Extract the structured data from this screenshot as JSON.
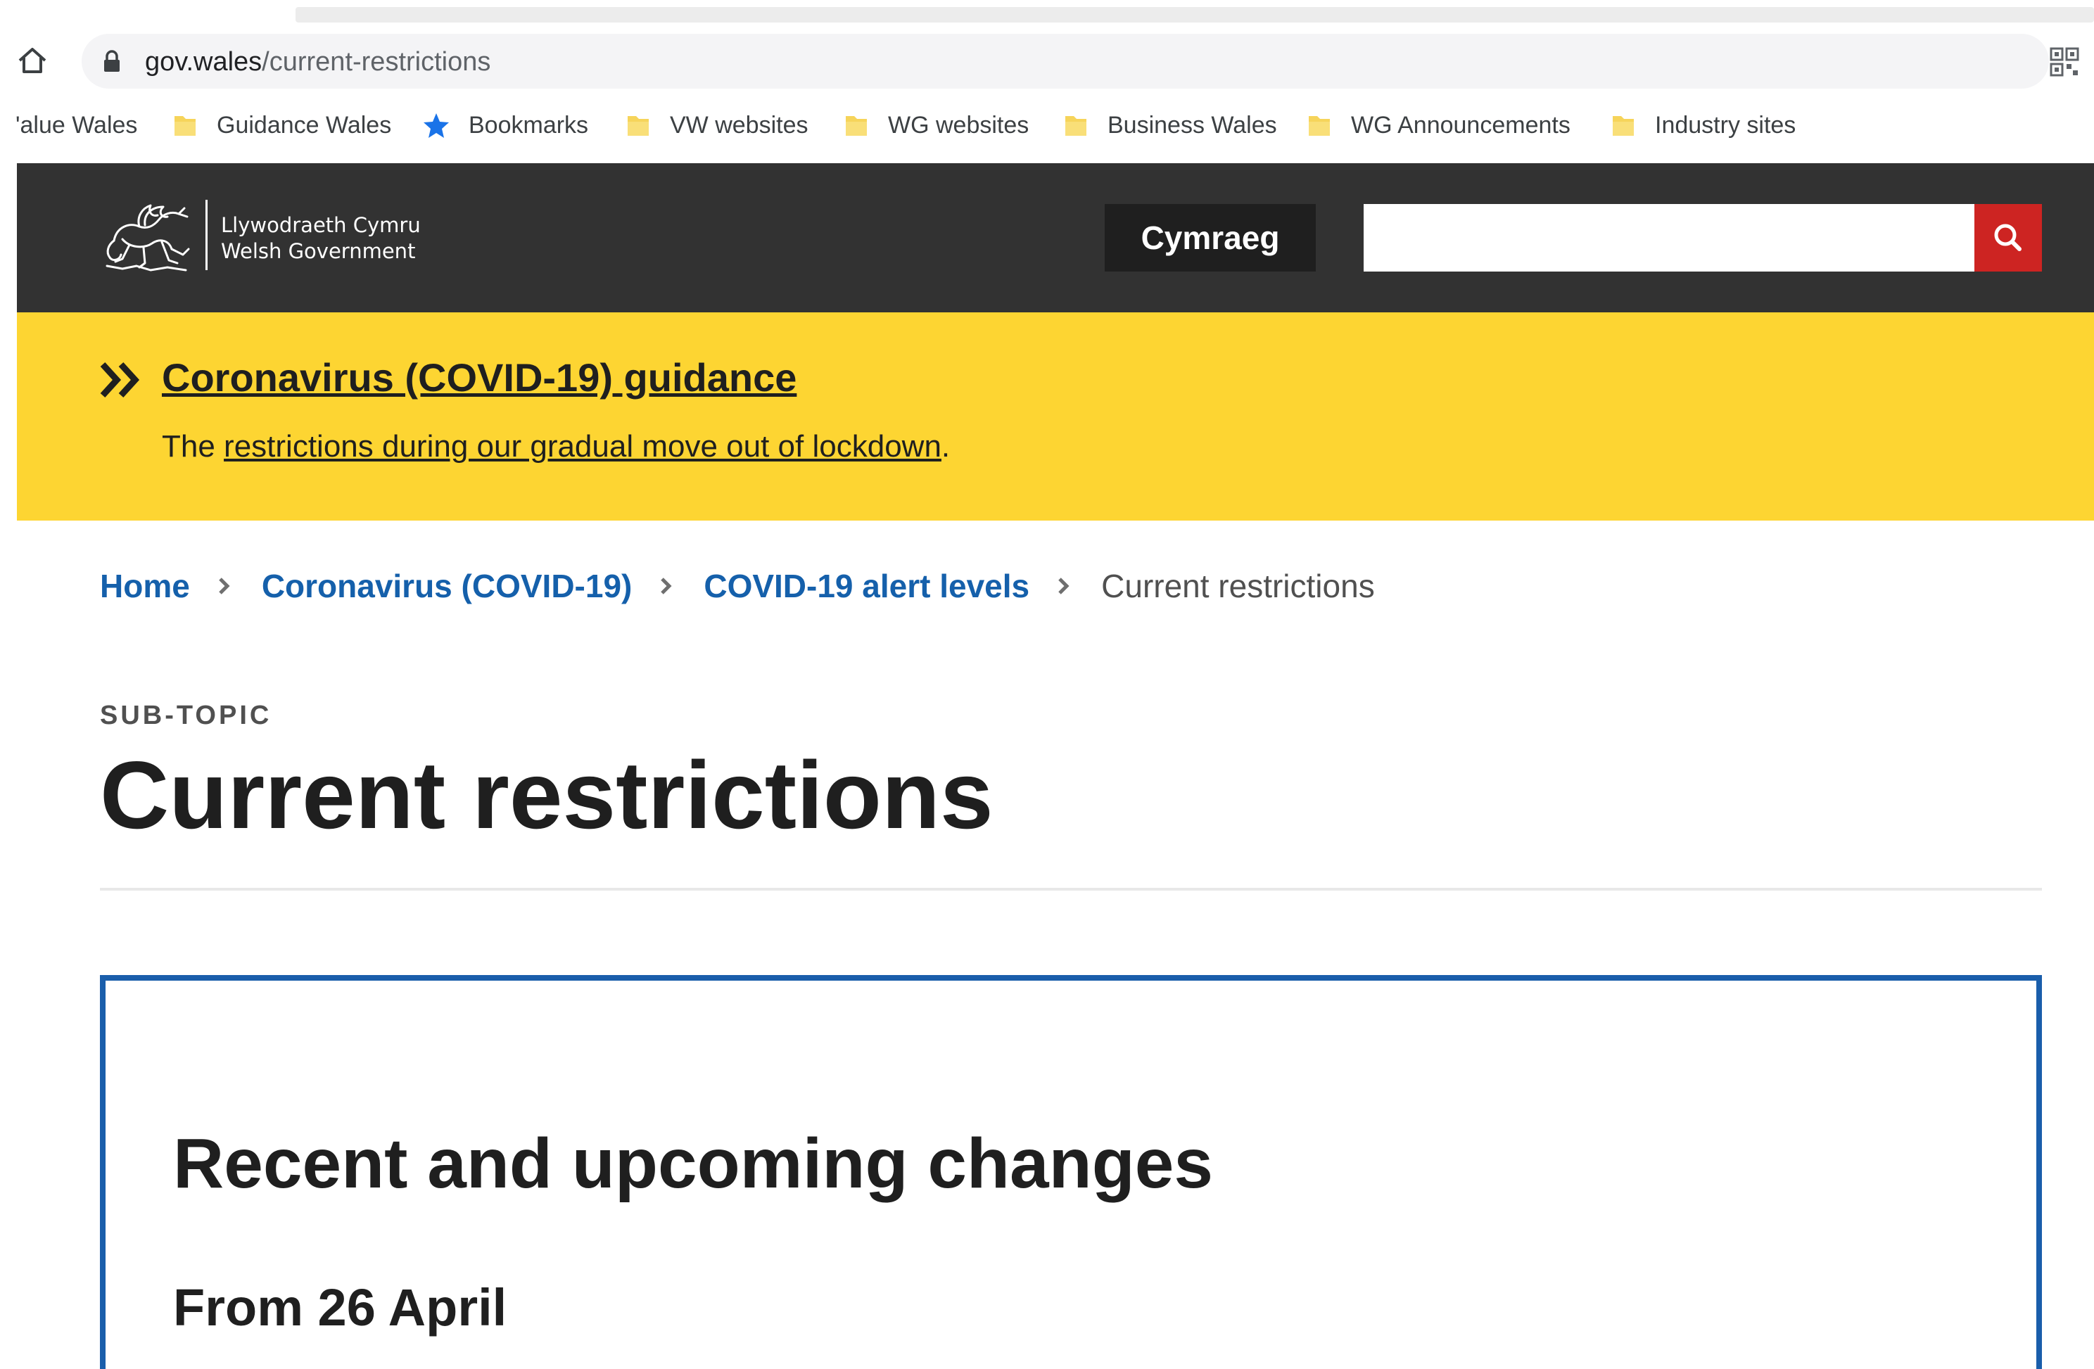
{
  "browser": {
    "url_domain": "gov.wales",
    "url_path": "/current-restrictions",
    "bookmarks": [
      {
        "label": "'alue Wales",
        "icon": "none"
      },
      {
        "label": "Guidance Wales",
        "icon": "folder-icon"
      },
      {
        "label": "Bookmarks",
        "icon": "star-icon"
      },
      {
        "label": "VW websites",
        "icon": "folder-icon"
      },
      {
        "label": "WG websites",
        "icon": "folder-icon"
      },
      {
        "label": "Business Wales",
        "icon": "folder-icon"
      },
      {
        "label": "WG Announcements",
        "icon": "folder-icon"
      },
      {
        "label": "Industry sites",
        "icon": "folder-icon"
      }
    ]
  },
  "header": {
    "logo_line1": "Llywodraeth Cymru",
    "logo_line2": "Welsh Government",
    "language_button": "Cymraeg",
    "search_placeholder": "",
    "search_value": ""
  },
  "banner": {
    "title": "Coronavirus (COVID-19) guidance",
    "text_prefix": "The ",
    "link_text": "restrictions during our gradual move out of lockdown",
    "text_suffix": "."
  },
  "breadcrumb": {
    "items": [
      "Home",
      "Coronavirus (COVID-19)",
      "COVID-19 alert levels"
    ],
    "current": "Current restrictions"
  },
  "page": {
    "label": "SUB-TOPIC",
    "title": "Current restrictions"
  },
  "changes": {
    "title": "Recent and upcoming changes",
    "subtitle": "From 26 April"
  },
  "colors": {
    "header_bg": "#323232",
    "banner_bg": "#fdd532",
    "search_button": "#cd2422",
    "link_blue": "#1560ab",
    "box_border": "#1a5eab",
    "folder_yellow": "#f6d45a",
    "star_blue": "#1a73e8"
  }
}
